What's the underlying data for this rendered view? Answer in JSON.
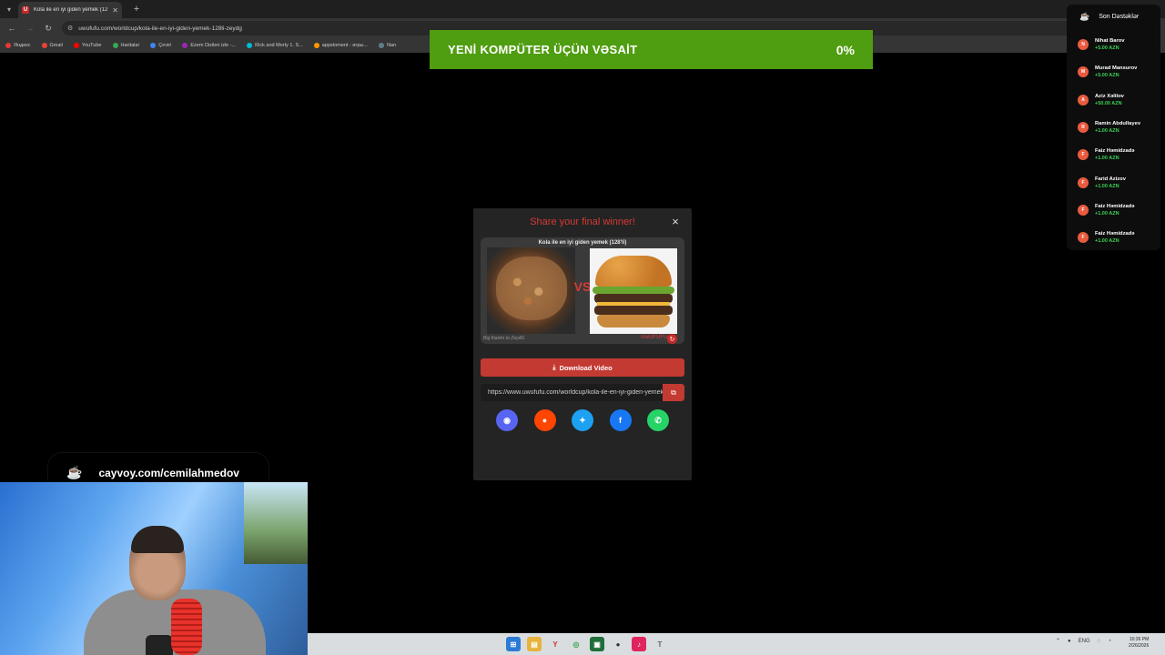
{
  "browser": {
    "tab_title": "Kola ile en iyi giden yemek (128...",
    "tab_favicon_letter": "U",
    "new_tab": "+",
    "url": "uwufufu.com/worldcup/kola-ile-en-iyi-giden-yemek-128li-zeydg",
    "bookmarks": [
      {
        "label": "Яндекс",
        "color": "#e53935"
      },
      {
        "label": "Gmail",
        "color": "#ea4335"
      },
      {
        "label": "YouTube",
        "color": "#ff0000"
      },
      {
        "label": "Haritalar",
        "color": "#34a853"
      },
      {
        "label": "Çeviri",
        "color": "#4285f4"
      },
      {
        "label": "Ezem Dizileri izle -...",
        "color": "#9c27b0"
      },
      {
        "label": "Rick and Morty 1. S...",
        "color": "#00bcd4"
      },
      {
        "label": "appstoment - игры...",
        "color": "#ff9800"
      },
      {
        "label": "Nan",
        "color": "#607d8b"
      }
    ]
  },
  "goal": {
    "title": "YENİ KOMPÜTER ÜÇÜN VƏSAİT",
    "percent": "0%"
  },
  "supporters": {
    "title": "Son Dəstəklər",
    "items": [
      {
        "initial": "N",
        "name": "Nihat Barov",
        "amount": "+5.00 AZN"
      },
      {
        "initial": "M",
        "name": "Murad Mansurov",
        "amount": "+5.00 AZN"
      },
      {
        "initial": "A",
        "name": "Aziz Xəlilov",
        "amount": "+50.00 AZN"
      },
      {
        "initial": "R",
        "name": "Ramin Abdullayev",
        "amount": "+1.00 AZN"
      },
      {
        "initial": "F",
        "name": "Faiz Həmidzadə",
        "amount": "+1.00 AZN"
      },
      {
        "initial": "F",
        "name": "Farid Azizov",
        "amount": "+1.00 AZN"
      },
      {
        "initial": "F",
        "name": "Faiz Həmidzadə",
        "amount": "+1.00 AZN"
      },
      {
        "initial": "F",
        "name": "Faiz Həmidzadə",
        "amount": "+1.00 AZN"
      }
    ]
  },
  "modal": {
    "title": "Share your final winner!",
    "close": "×",
    "preview_title": "Kola ile en iyi giden yemek (128'li)",
    "vs": "VS",
    "credit": "Big thanks to ZeydG",
    "brand": "UwUFUFU",
    "download_label": "Download Video",
    "share_url": "https://www.uwufufu.com/worldcup/kola-ile-en-iyi-giden-yemek-128li-zeydg",
    "socials": [
      {
        "name": "discord",
        "glyph": "◉",
        "color": "#5865f2"
      },
      {
        "name": "reddit",
        "glyph": "●",
        "color": "#ff4500"
      },
      {
        "name": "twitter",
        "glyph": "✦",
        "color": "#1da1f2"
      },
      {
        "name": "facebook",
        "glyph": "f",
        "color": "#1877f2"
      },
      {
        "name": "whatsapp",
        "glyph": "✆",
        "color": "#25d366"
      }
    ]
  },
  "caption": {
    "text": "cayvoy.com/cemilahmedov"
  },
  "taskbar": {
    "tray_lang": "ENG",
    "clock_time": "10:36 PM",
    "clock_date": "2/26/2026"
  }
}
